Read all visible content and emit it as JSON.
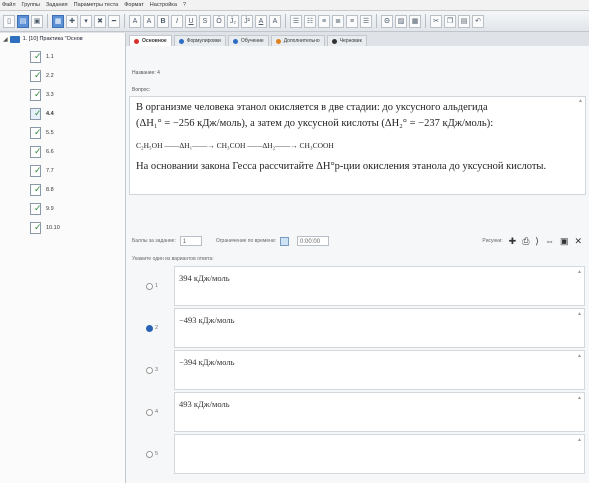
{
  "menu": [
    "Файл",
    "Группы",
    "Задания",
    "Параметры теста",
    "Формат",
    "Настройка",
    "?"
  ],
  "toolbar": {
    "font_buttons": [
      "A",
      "A",
      "B",
      "I",
      "U",
      "S",
      "Ö",
      "Ĵ₂",
      "Ĵ²",
      "A",
      "A"
    ]
  },
  "tree": {
    "root": "1. [10] Практика \"Основ",
    "items": [
      "1.1",
      "2.2",
      "3.3",
      "4.4",
      "5.5",
      "6.6",
      "7.7",
      "8.8",
      "9.9",
      "10.10"
    ],
    "active_index": 3
  },
  "tabs": [
    {
      "label": "Основное",
      "color": "#d9302c",
      "active": true
    },
    {
      "label": "Формулировки",
      "color": "#2d6cc4",
      "active": false
    },
    {
      "label": "Обучение",
      "color": "#2d6cc4",
      "active": false
    },
    {
      "label": "Дополнительно",
      "color": "#e0801e",
      "active": false
    },
    {
      "label": "Черновик",
      "color": "#333333",
      "active": false
    }
  ],
  "form": {
    "name_label": "Название:",
    "name_value": "4",
    "question_label": "Вопрос:",
    "question": {
      "line1": "В организме человека этанол окисляется в две стадии: до уксусного альдегида",
      "line2": "(ΔH₁° = −256 кДж/моль), а затем до уксусной кислоты (ΔH₂° = −237 кДж/моль):",
      "equation": "C₂H₅OH ——ΔH₁——→ CH₃COH ——ΔH₂——→ CH₃COOH",
      "line3": "На основании закона Гесса рассчитайте ΔH°р-ции окисления этанола до уксусной кислоты."
    },
    "score_label": "Баллы за задание:",
    "score_value": "1",
    "time_label": "Ограничение по времени:",
    "time_value": "0:00:00",
    "pictures_label": "Рисунки:",
    "answers_label": "Укажите один из вариантов ответа:"
  },
  "answers": [
    {
      "num": "1",
      "text": "394 кДж/моль",
      "selected": false
    },
    {
      "num": "2",
      "text": "−493 кДж/моль",
      "selected": true
    },
    {
      "num": "3",
      "text": "−394 кДж/моль",
      "selected": false
    },
    {
      "num": "4",
      "text": "493 кДж/моль",
      "selected": false
    },
    {
      "num": "5",
      "text": "",
      "selected": false
    }
  ]
}
